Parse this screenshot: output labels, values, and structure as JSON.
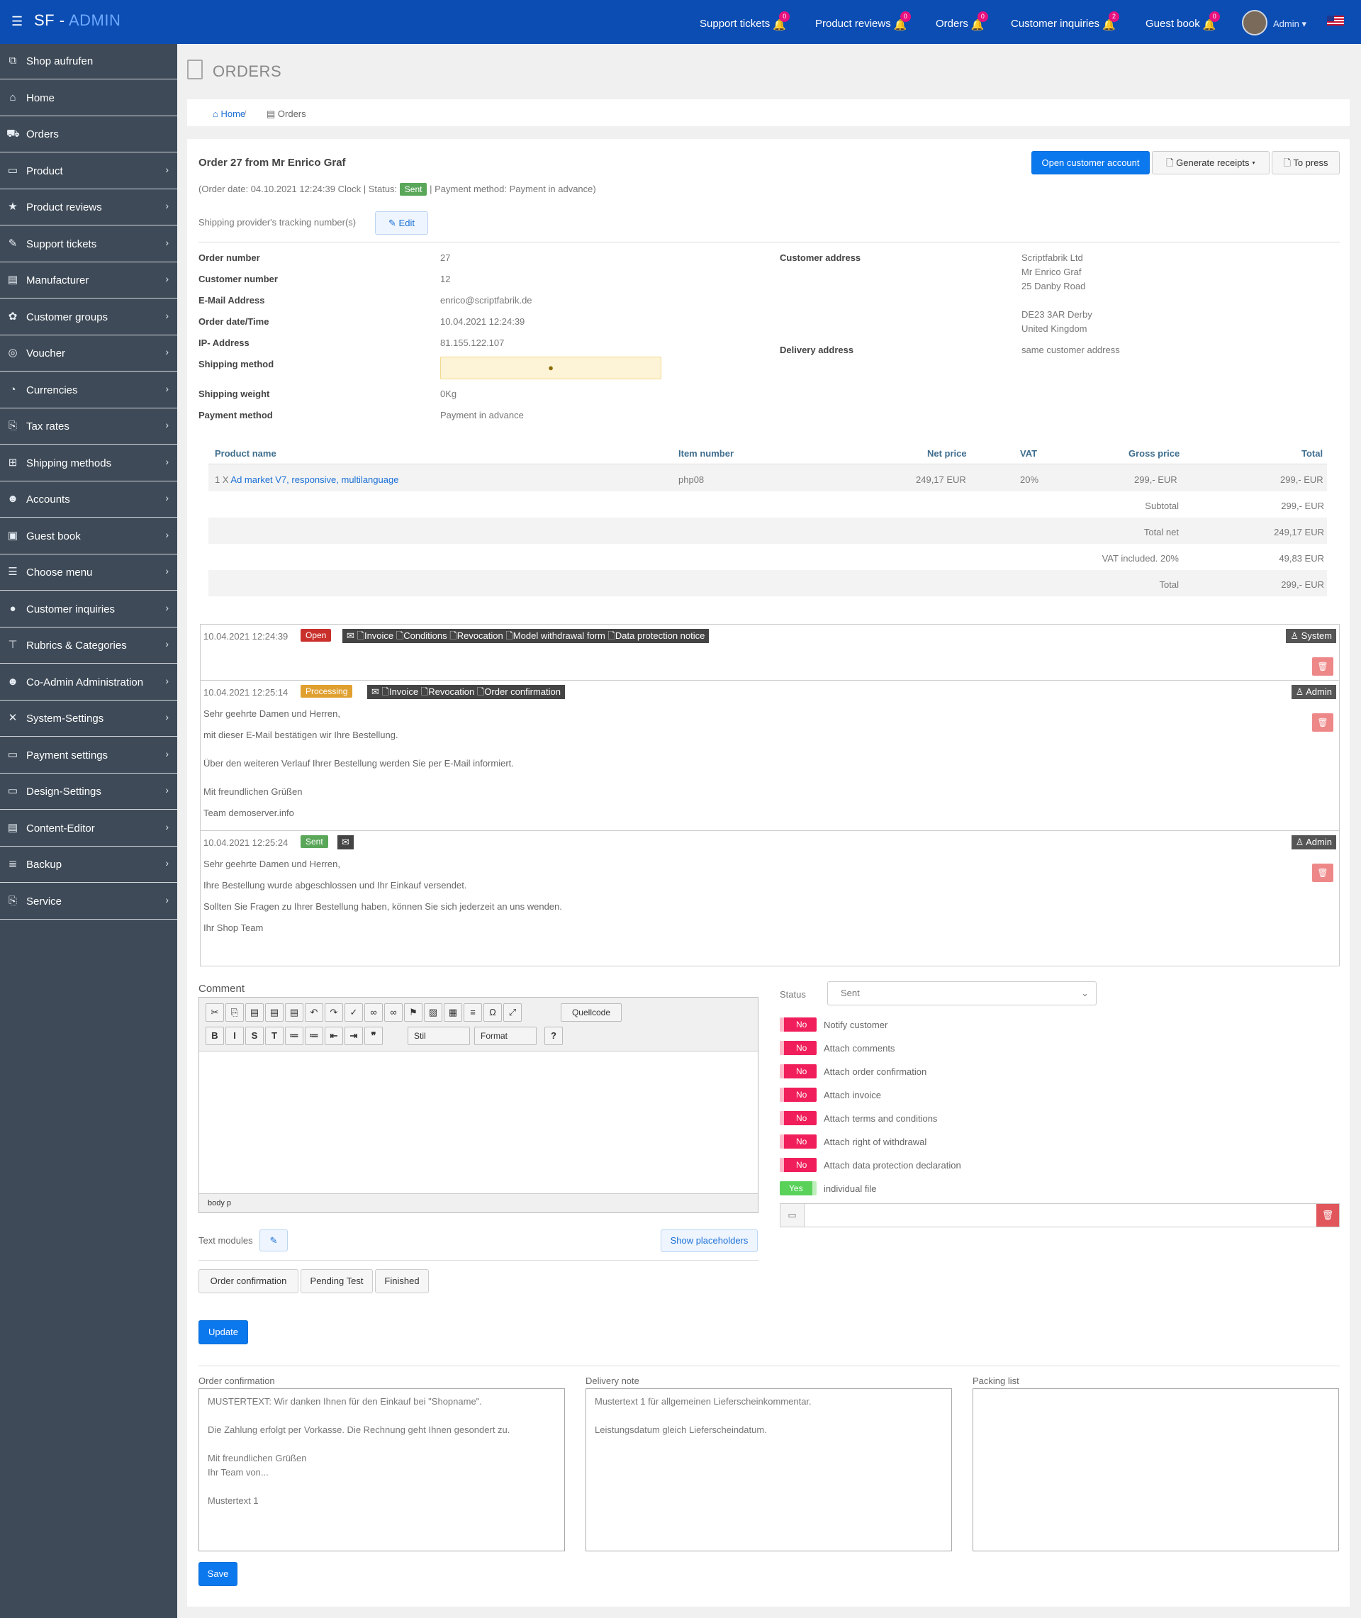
{
  "app": {
    "logo_sf": "SF",
    "logo_dash": " - ",
    "logo_admin": "ADMIN",
    "menu_icon": "menu-icon"
  },
  "topnav": [
    {
      "label": "Support tickets",
      "count": "0"
    },
    {
      "label": "Product reviews",
      "count": "0"
    },
    {
      "label": "Orders",
      "count": "0"
    },
    {
      "label": "Customer inquiries",
      "count": "2"
    },
    {
      "label": "Guest book",
      "count": "0"
    }
  ],
  "user": {
    "name": "Admin"
  },
  "sidebar": [
    {
      "label": "Shop aufrufen",
      "icon": "external-link-icon",
      "glyph": "⧉",
      "chevron": false
    },
    {
      "label": "Home",
      "icon": "home-icon",
      "glyph": "⌂",
      "chevron": false
    },
    {
      "label": "Orders",
      "icon": "cart-icon",
      "glyph": "⛟",
      "chevron": false
    },
    {
      "label": "Product",
      "icon": "box-icon",
      "glyph": "▭",
      "chevron": true
    },
    {
      "label": "Product reviews",
      "icon": "star-icon",
      "glyph": "★",
      "chevron": true
    },
    {
      "label": "Support tickets",
      "icon": "ticket-icon",
      "glyph": "✎",
      "chevron": true
    },
    {
      "label": "Manufacturer",
      "icon": "building-icon",
      "glyph": "▤",
      "chevron": true
    },
    {
      "label": "Customer groups",
      "icon": "group-icon",
      "glyph": "✿",
      "chevron": true
    },
    {
      "label": "Voucher",
      "icon": "voucher-icon",
      "glyph": "◎",
      "chevron": true
    },
    {
      "label": "Currencies",
      "icon": "currency-icon",
      "glyph": "◔",
      "chevron": true
    },
    {
      "label": "Tax rates",
      "icon": "tax-icon",
      "glyph": "⎘",
      "chevron": true
    },
    {
      "label": "Shipping methods",
      "icon": "gift-icon",
      "glyph": "⊞",
      "chevron": true
    },
    {
      "label": "Accounts",
      "icon": "users-icon",
      "glyph": "☻",
      "chevron": true
    },
    {
      "label": "Guest book",
      "icon": "book-icon",
      "glyph": "▣",
      "chevron": true
    },
    {
      "label": "Choose menu",
      "icon": "menu-list-icon",
      "glyph": "☰",
      "chevron": true
    },
    {
      "label": "Customer inquiries",
      "icon": "comment-icon",
      "glyph": "●",
      "chevron": true
    },
    {
      "label": "Rubrics & Categories",
      "icon": "sitemap-icon",
      "glyph": "⊤",
      "chevron": true
    },
    {
      "label": "Co-Admin Administration",
      "icon": "users-cog-icon",
      "glyph": "☻",
      "chevron": true
    },
    {
      "label": "System-Settings",
      "icon": "tools-icon",
      "glyph": "✕",
      "chevron": true
    },
    {
      "label": "Payment settings",
      "icon": "credit-card-icon",
      "glyph": "▭",
      "chevron": true
    },
    {
      "label": "Design-Settings",
      "icon": "monitor-icon",
      "glyph": "▭",
      "chevron": true
    },
    {
      "label": "Content-Editor",
      "icon": "editor-icon",
      "glyph": "▤",
      "chevron": true
    },
    {
      "label": "Backup",
      "icon": "database-icon",
      "glyph": "≣",
      "chevron": true
    },
    {
      "label": "Service",
      "icon": "service-icon",
      "glyph": "⎘",
      "chevron": true
    }
  ],
  "page": {
    "title": "ORDERS"
  },
  "breadcrumb": {
    "home": "Home",
    "current": "Orders"
  },
  "order": {
    "heading": "Order 27 from Mr Enrico Graf",
    "meta_prefix": "(Order date: 04.10.2021 12:24:39 Clock | Status:",
    "status": "Sent",
    "meta_suffix": "| Payment method: Payment in advance)",
    "tracking_label": "Shipping provider's tracking number(s)",
    "edit_label": "Edit",
    "buttons": {
      "open_account": "Open customer account",
      "receipts": "Generate receipts",
      "press": "To press"
    }
  },
  "details": [
    {
      "label": "Order number",
      "value": "27"
    },
    {
      "label": "Customer number",
      "value": "12"
    },
    {
      "label": "E-Mail Address",
      "value": "enrico@scriptfabrik.de"
    },
    {
      "label": "Order date/Time",
      "value": "10.04.2021 12:24:39"
    },
    {
      "label": "IP- Address",
      "value": "81.155.122.107"
    },
    {
      "label": "Shipping method",
      "value": ""
    },
    {
      "label": "Shipping weight",
      "value": "0Kg"
    },
    {
      "label": "Payment method",
      "value": "Payment in advance"
    }
  ],
  "address": {
    "customer_label": "Customer address",
    "customer_lines": [
      "Scriptfabrik Ltd",
      "Mr Enrico Graf",
      "25 Danby Road",
      "",
      "DE23 3AR Derby",
      "United Kingdom"
    ],
    "delivery_label": "Delivery address",
    "delivery_value": "same customer address"
  },
  "items": {
    "headers": {
      "name": "Product name",
      "item": "Item number",
      "net": "Net price",
      "vat": "VAT",
      "gross": "Gross price",
      "total": "Total"
    },
    "rows": [
      {
        "qty": "1 X",
        "name": "Ad market V7, responsive, multilanguage",
        "item": "php08",
        "net": "249,17 EUR",
        "vat": "20%",
        "gross": "299,- EUR",
        "total": "299,- EUR"
      }
    ],
    "totals": [
      {
        "label": "Subtotal",
        "value": "299,- EUR"
      },
      {
        "label": "Total net",
        "value": "249,17 EUR"
      },
      {
        "label": "VAT included. 20%",
        "value": "49,83 EUR"
      },
      {
        "label": "Total",
        "value": "299,- EUR"
      }
    ]
  },
  "history": [
    {
      "time": "10.04.2021 12:24:39",
      "status": "Open",
      "color": "#c9302c",
      "docs": "✉ 🗋Invoice 🗋Conditions 🗋Revocation 🗋Model withdrawal form 🗋Data protection notice",
      "who": "System",
      "lines": []
    },
    {
      "time": "10.04.2021 12:25:14",
      "status": "Processing",
      "color": "#e0a030",
      "docs": "✉ 🗋Invoice 🗋Revocation 🗋Order confirmation",
      "who": "Admin",
      "lines": [
        "Sehr geehrte Damen und Herren,",
        "mit dieser E-Mail bestätigen wir Ihre Bestellung.",
        "Über den weiteren Verlauf Ihrer Bestellung werden Sie per E-Mail informiert.",
        "Mit freundlichen Grüßen",
        "Team demoserver.info"
      ]
    },
    {
      "time": "10.04.2021 12:25:24",
      "status": "Sent",
      "color": "#5aa75a",
      "docs": "✉",
      "who": "Admin",
      "lines": [
        "Sehr geehrte Damen und Herren,",
        "Ihre Bestellung wurde abgeschlossen und Ihr Einkauf versendet.",
        "Sollten Sie Fragen zu Ihrer Bestellung haben, können Sie sich jederzeit an uns wenden.",
        "Ihr Shop Team"
      ]
    }
  ],
  "comment": {
    "label": "Comment",
    "source_btn": "Quellcode",
    "style_select": "Stil",
    "format_select": "Format",
    "path": "body  p",
    "text_modules_label": "Text modules",
    "placeholders_btn": "Show placeholders",
    "templates": [
      "Order confirmation",
      "Pending Test",
      "Finished"
    ],
    "update_btn": "Update"
  },
  "status_panel": {
    "label": "Status",
    "value": "Sent",
    "toggles": [
      {
        "state": "No",
        "label": "Notify customer"
      },
      {
        "state": "No",
        "label": "Attach comments"
      },
      {
        "state": "No",
        "label": "Attach order confirmation"
      },
      {
        "state": "No",
        "label": "Attach invoice"
      },
      {
        "state": "No",
        "label": "Attach terms and conditions"
      },
      {
        "state": "No",
        "label": "Attach right of withdrawal"
      },
      {
        "state": "No",
        "label": "Attach data protection declaration"
      },
      {
        "state": "Yes",
        "label": "individual file"
      }
    ]
  },
  "notes": {
    "order_confirmation": {
      "label": "Order confirmation",
      "text": "MUSTERTEXT: Wir danken Ihnen für den Einkauf bei \"Shopname\".\n\nDie Zahlung erfolgt per Vorkasse. Die Rechnung geht Ihnen gesondert zu.\n\nMit freundlichen Grüßen\nIhr Team von...\n\nMustertext 1"
    },
    "delivery_note": {
      "label": "Delivery note",
      "text": "Mustertext 1 für allgemeinen Lieferscheinkommentar.\n\nLeistungsdatum gleich Lieferscheindatum."
    },
    "packing_list": {
      "label": "Packing list",
      "text": ""
    },
    "save_btn": "Save"
  },
  "colors": {
    "topbar": "#0b4db3",
    "sidebar": "#3e4a57",
    "primary": "#0b78ee",
    "toggle_no": "#f01e5a",
    "toggle_yes": "#5ad25a"
  }
}
